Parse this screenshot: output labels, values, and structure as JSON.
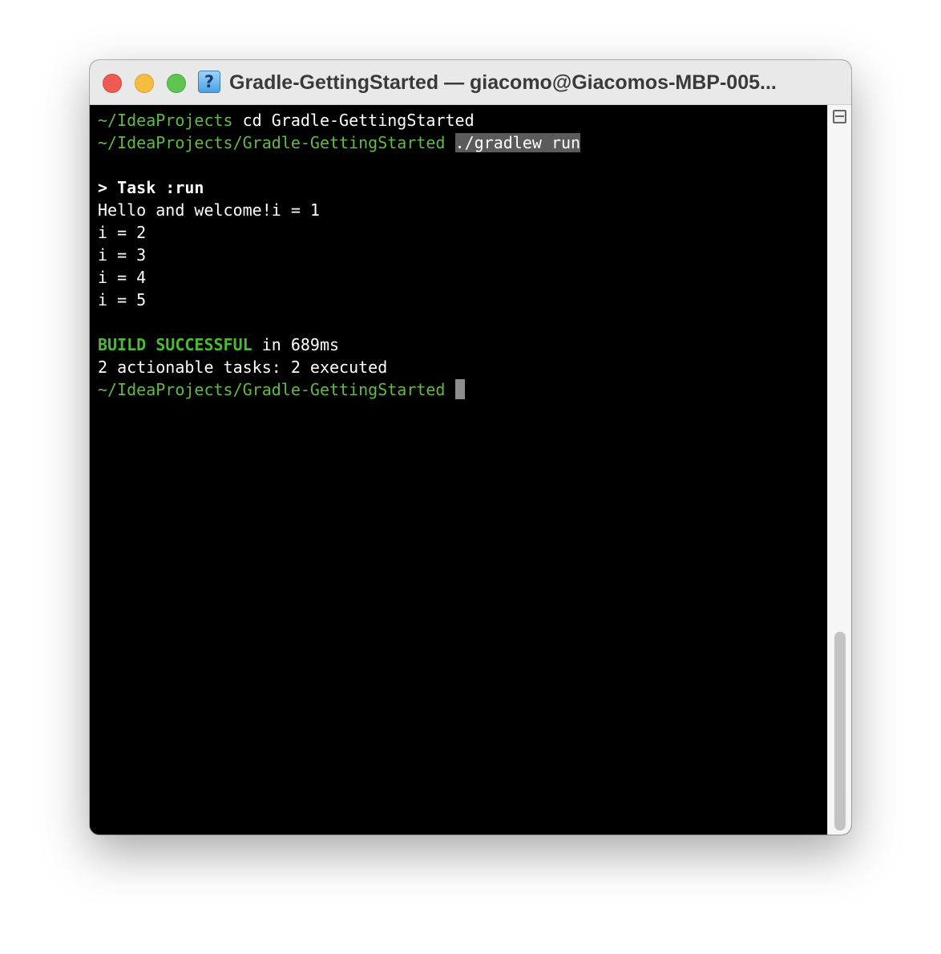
{
  "window": {
    "title": "Gradle-GettingStarted — giacomo@Giacomos-MBP-005...",
    "title_icon_name": "terminal-question-icon",
    "title_icon_glyph": "?"
  },
  "terminal": {
    "lines": [
      {
        "prompt": "~/IdeaProjects",
        "command": " cd Gradle-GettingStarted"
      },
      {
        "prompt": "~/IdeaProjects/Gradle-GettingStarted",
        "space": " ",
        "command_highlighted": "./gradlew run"
      },
      {
        "text": ""
      },
      {
        "text": "> Task :run"
      },
      {
        "text": "Hello and welcome!i = 1"
      },
      {
        "text": "i = 2"
      },
      {
        "text": "i = 3"
      },
      {
        "text": "i = 4"
      },
      {
        "text": "i = 5"
      },
      {
        "text": ""
      },
      {
        "status": "BUILD SUCCESSFUL",
        "rest": " in 689ms"
      },
      {
        "text": "2 actionable tasks: 2 executed"
      },
      {
        "prompt": "~/IdeaProjects/Gradle-GettingStarted",
        "space": " "
      }
    ]
  },
  "colors": {
    "prompt": "#64b84a",
    "build_success": "#4fb83a",
    "highlight": "#5b5b5b",
    "background": "#000000"
  }
}
